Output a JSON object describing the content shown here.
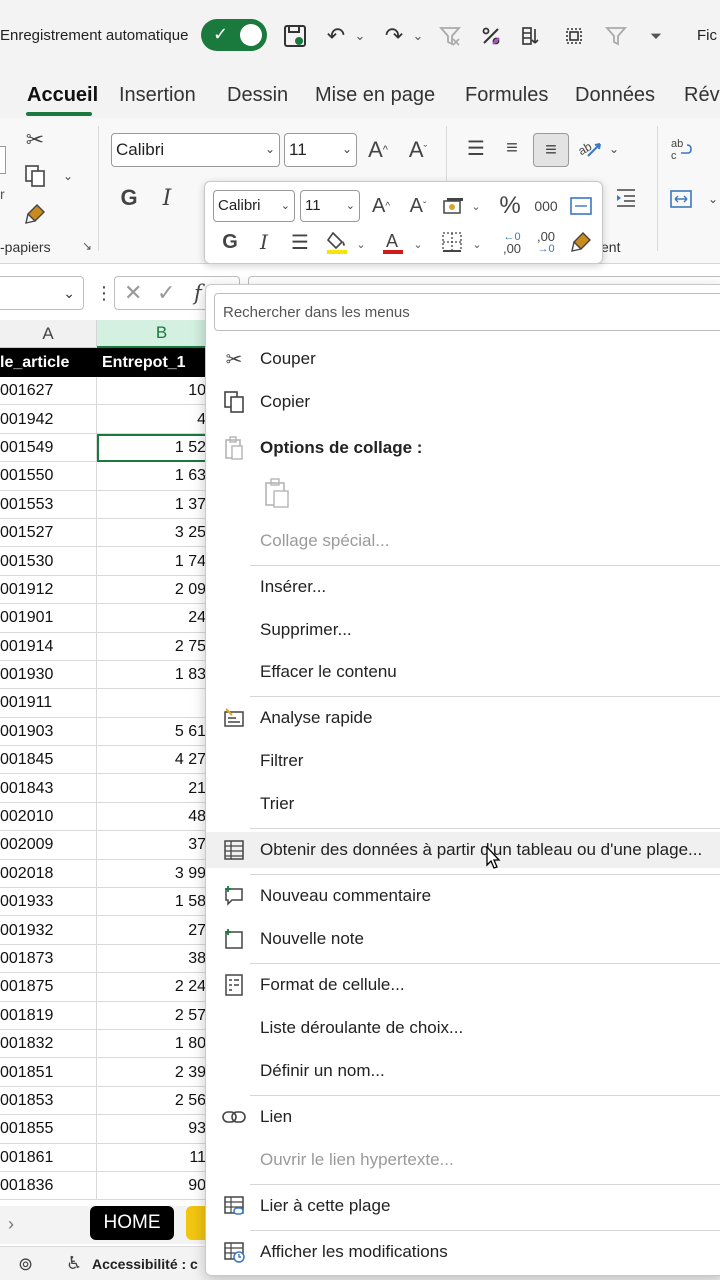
{
  "titlebar": {
    "autosave_label": "Enregistrement automatique",
    "file_fragment": "Fic",
    "icons": [
      "save-icon",
      "undo-icon",
      "redo-icon",
      "clear-filter-icon",
      "percent-icon",
      "sort-icon",
      "select-icon",
      "filter-icon",
      "customize-icon"
    ]
  },
  "ribbon": {
    "tabs": [
      "Accueil",
      "Insertion",
      "Dessin",
      "Mise en page",
      "Formules",
      "Données",
      "Révi"
    ],
    "active_tab": "Accueil",
    "font_name": "Calibri",
    "font_size": "11",
    "clipboard_label": "-papiers",
    "align_label_fragment": "ent",
    "bold_label": "G",
    "italic_label": "I"
  },
  "mini_toolbar": {
    "font_name": "Calibri",
    "font_size": "11",
    "bold_label": "G",
    "italic_label": "I",
    "percent_label": "%",
    "thousands_label": "000",
    "increase_decimal_label": ",00",
    "decrease_decimal_label": ",00"
  },
  "formula_bar": {
    "fx_label": "f"
  },
  "grid": {
    "col_headers": [
      "A",
      "B"
    ],
    "header_cells": [
      "le_article",
      "Entrepot_1"
    ],
    "rows": [
      {
        "a": "001627",
        "b": "10"
      },
      {
        "a": "001942",
        "b": "4"
      },
      {
        "a": "001549",
        "b": "1 52"
      },
      {
        "a": "001550",
        "b": "1 63"
      },
      {
        "a": "001553",
        "b": "1 37"
      },
      {
        "a": "001527",
        "b": "3 25"
      },
      {
        "a": "001530",
        "b": "1 74"
      },
      {
        "a": "001912",
        "b": "2 09"
      },
      {
        "a": "001901",
        "b": "24"
      },
      {
        "a": "001914",
        "b": "2 75"
      },
      {
        "a": "001930",
        "b": "1 83"
      },
      {
        "a": "001911",
        "b": ""
      },
      {
        "a": "001903",
        "b": "5 61"
      },
      {
        "a": "001845",
        "b": "4 27"
      },
      {
        "a": "001843",
        "b": "21"
      },
      {
        "a": "002010",
        "b": "48"
      },
      {
        "a": "002009",
        "b": "37"
      },
      {
        "a": "002018",
        "b": "3 99"
      },
      {
        "a": "001933",
        "b": "1 58"
      },
      {
        "a": "001932",
        "b": "27"
      },
      {
        "a": "001873",
        "b": "38"
      },
      {
        "a": "001875",
        "b": "2 24"
      },
      {
        "a": "001819",
        "b": "2 57"
      },
      {
        "a": "001832",
        "b": "1 80"
      },
      {
        "a": "001851",
        "b": "2 39"
      },
      {
        "a": "001853",
        "b": "2 56"
      },
      {
        "a": "001855",
        "b": "93"
      },
      {
        "a": "001861",
        "b": "11"
      },
      {
        "a": "001836",
        "b": "90"
      }
    ]
  },
  "sheetbar": {
    "sheet_home": "HOME"
  },
  "statusbar": {
    "accessibility": "Accessibilité : c"
  },
  "context_menu": {
    "search_placeholder": "Rechercher dans les menus",
    "items": [
      {
        "label": "Couper",
        "icon": "scissors-icon"
      },
      {
        "label": "Copier",
        "icon": "copy-icon"
      },
      {
        "label": "Options de collage :",
        "icon": "paste-icon"
      },
      {
        "label": "Collage spécial...",
        "icon": ""
      },
      {
        "label": "Insérer...",
        "icon": ""
      },
      {
        "label": "Supprimer...",
        "icon": ""
      },
      {
        "label": "Effacer le contenu",
        "icon": ""
      },
      {
        "label": "Analyse rapide",
        "icon": "quick-analysis-icon"
      },
      {
        "label": "Filtrer",
        "icon": ""
      },
      {
        "label": "Trier",
        "icon": ""
      },
      {
        "label": "Obtenir des données à partir d'un tableau ou d'une plage...",
        "icon": "table-icon"
      },
      {
        "label": "Nouveau commentaire",
        "icon": "new-comment-icon"
      },
      {
        "label": "Nouvelle note",
        "icon": "new-note-icon"
      },
      {
        "label": "Format de cellule...",
        "icon": "format-cells-icon"
      },
      {
        "label": "Liste déroulante de choix...",
        "icon": ""
      },
      {
        "label": "Définir un nom...",
        "icon": ""
      },
      {
        "label": "Lien",
        "icon": "link-icon"
      },
      {
        "label": "Ouvrir le lien hypertexte...",
        "icon": ""
      },
      {
        "label": "Lier à cette plage",
        "icon": "link-range-icon"
      },
      {
        "label": "Afficher les modifications",
        "icon": "show-changes-icon"
      }
    ]
  },
  "colors": {
    "accent_green": "#1a7a3d",
    "header_black": "#000000",
    "sheet_tab_yellow": "#f2c511"
  }
}
